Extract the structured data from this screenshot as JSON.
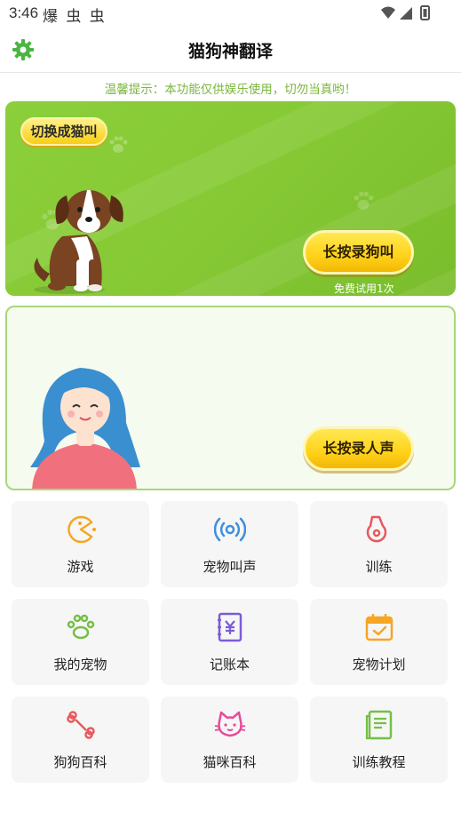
{
  "status_bar": {
    "time": "3:46",
    "apps": "爆 虫 虫"
  },
  "header": {
    "title": "猫狗神翻译",
    "settings_icon": "gear-icon"
  },
  "tip": "温馨提示：本功能仅供娱乐使用，切勿当真哟！",
  "dog_card": {
    "switch_label": "切换成猫叫",
    "record_label": "长按录狗叫",
    "free_trial": "免费试用1次"
  },
  "person_card": {
    "record_label": "长按录人声"
  },
  "grid": [
    {
      "label": "游戏",
      "icon": "pacman-icon"
    },
    {
      "label": "宠物叫声",
      "icon": "broadcast-icon"
    },
    {
      "label": "训练",
      "icon": "whistle-icon"
    },
    {
      "label": "我的宠物",
      "icon": "paw-icon"
    },
    {
      "label": "记账本",
      "icon": "ledger-icon"
    },
    {
      "label": "宠物计划",
      "icon": "calendar-check-icon"
    },
    {
      "label": "狗狗百科",
      "icon": "bone-icon"
    },
    {
      "label": "猫咪百科",
      "icon": "cat-face-icon"
    },
    {
      "label": "训练教程",
      "icon": "book-icon"
    }
  ],
  "colors": {
    "accent_green": "#86c935",
    "tip_green": "#7bb63d",
    "button_yellow": "#ffd21a"
  }
}
